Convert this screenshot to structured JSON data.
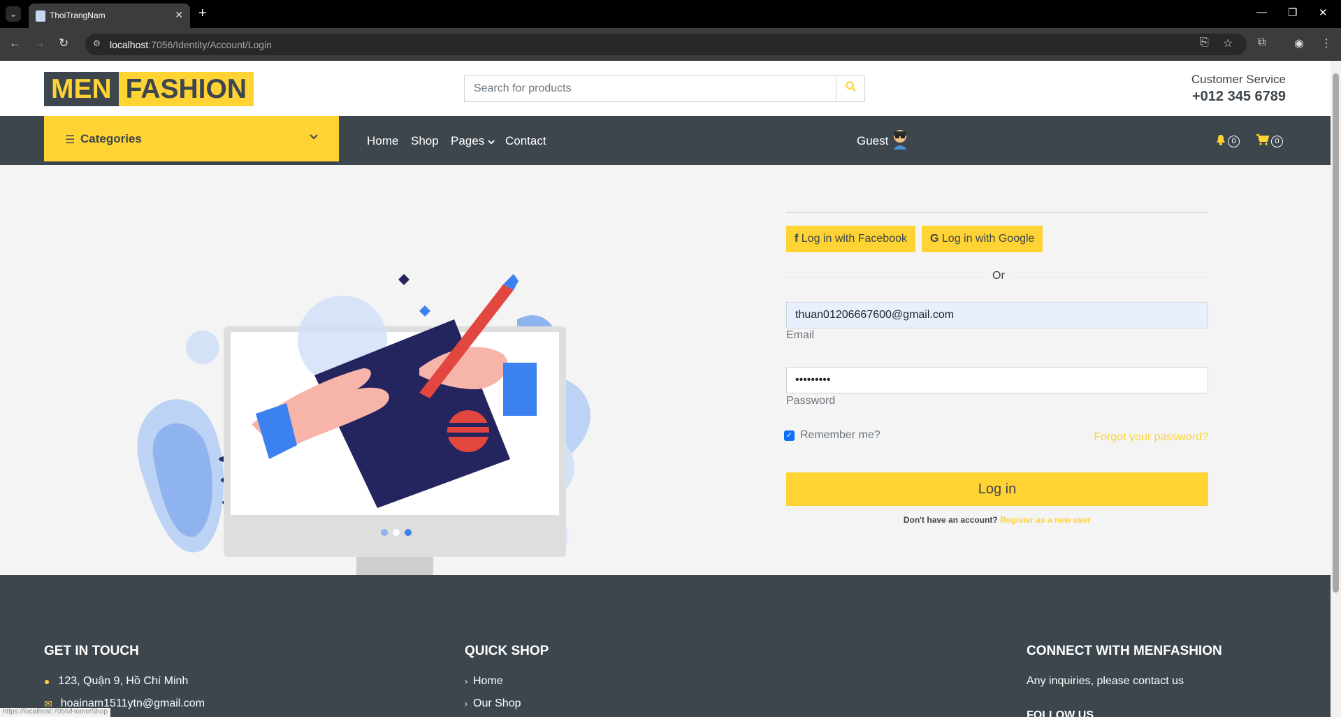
{
  "browser": {
    "tab_title": "ThoiTrangNam",
    "url_host": "localhost",
    "url_rest": ":7056/Identity/Account/Login",
    "status_url": "https://localhost:7056/Home/Shop"
  },
  "header": {
    "logo_part1": "MEN",
    "logo_part2": "FASHION",
    "search_placeholder": "Search for products",
    "customer_service_label": "Customer Service",
    "customer_service_phone": "+012 345 6789"
  },
  "navbar": {
    "categories_label": "Categories",
    "links": [
      "Home",
      "Shop",
      "Pages",
      "Contact"
    ],
    "user_label": "Guest",
    "notification_count": "0",
    "cart_count": "0"
  },
  "login": {
    "facebook_label": "Log in with Facebook",
    "google_label": "Log in with Google",
    "or_label": "Or",
    "email_value": "thuan01206667600@gmail.com",
    "email_label": "Email",
    "password_value": "•••••••••",
    "password_label": "Password",
    "remember_label": "Remember me?",
    "remember_checked": true,
    "forgot_label": "Forgot your password?",
    "login_button": "Log in",
    "register_prompt": "Don't have an account?",
    "register_link": "Register as a new user"
  },
  "footer": {
    "get_in_touch": {
      "heading": "GET IN TOUCH",
      "address": "123, Quận 9, Hồ Chí Minh",
      "email": "hoainam1511ytn@gmail.com"
    },
    "quick_shop": {
      "heading": "QUICK SHOP",
      "items": [
        "Home",
        "Our Shop"
      ]
    },
    "connect": {
      "heading": "CONNECT WITH MENFASHION",
      "text": "Any inquiries, please contact us",
      "follow": "FOLLOW US"
    }
  },
  "colors": {
    "accent": "#ffd333",
    "dark": "#3d464d",
    "background": "#f4f4f4"
  }
}
